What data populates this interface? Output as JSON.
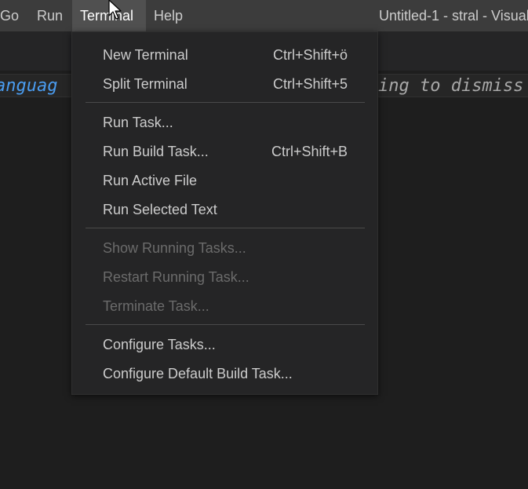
{
  "menubar": {
    "items": [
      {
        "label": "Go"
      },
      {
        "label": "Run"
      },
      {
        "label": "Terminal"
      },
      {
        "label": "Help"
      }
    ],
    "active": "Terminal",
    "window_title": "Untitled-1 - stral - Visual"
  },
  "editor": {
    "hint_left": "anguag",
    "hint_right": "ing to dismiss"
  },
  "terminal_menu": {
    "items": [
      {
        "label": "New Terminal",
        "shortcut": "Ctrl+Shift+ö",
        "enabled": true
      },
      {
        "label": "Split Terminal",
        "shortcut": "Ctrl+Shift+5",
        "enabled": true
      },
      {
        "label": "Run Task...",
        "shortcut": "",
        "enabled": true
      },
      {
        "label": "Run Build Task...",
        "shortcut": "Ctrl+Shift+B",
        "enabled": true
      },
      {
        "label": "Run Active File",
        "shortcut": "",
        "enabled": true
      },
      {
        "label": "Run Selected Text",
        "shortcut": "",
        "enabled": true
      },
      {
        "label": "Show Running Tasks...",
        "shortcut": "",
        "enabled": false
      },
      {
        "label": "Restart Running Task...",
        "shortcut": "",
        "enabled": false
      },
      {
        "label": "Terminate Task...",
        "shortcut": "",
        "enabled": false
      },
      {
        "label": "Configure Tasks...",
        "shortcut": "",
        "enabled": true
      },
      {
        "label": "Configure Default Build Task...",
        "shortcut": "",
        "enabled": true
      }
    ]
  },
  "colors": {
    "menubar_bg": "#3c3c3c",
    "menu_bg": "#252526",
    "editor_bg": "#1e1e1e",
    "text": "#cccccc",
    "disabled_text": "#6b6b6b",
    "hint_blue": "#4a9cf0"
  },
  "icons": {
    "cursor": "mouse-pointer-icon"
  }
}
